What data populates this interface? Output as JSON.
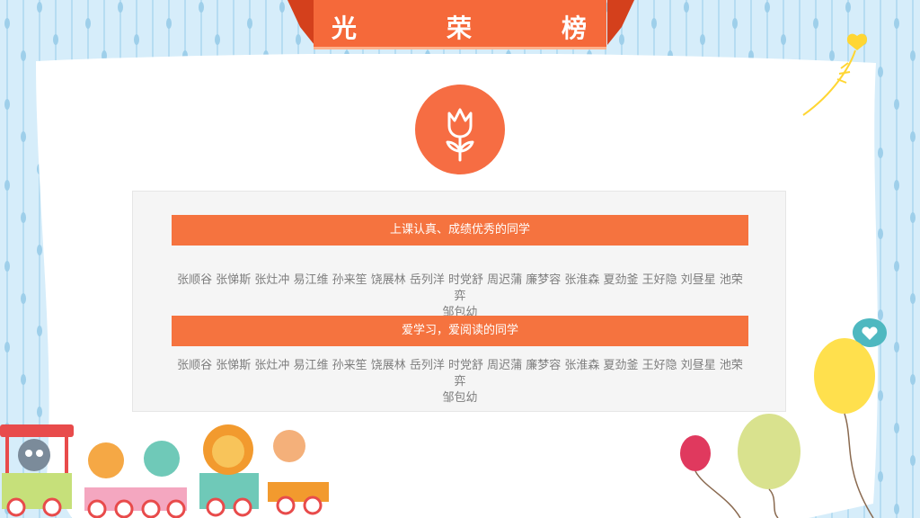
{
  "header": {
    "title_chars": [
      "光",
      "荣",
      "榜"
    ]
  },
  "icons": {
    "emblem": "tulip-icon",
    "bubble": "heart-speech-bubble-icon"
  },
  "sections": [
    {
      "heading": "上课认真、成绩优秀的同学",
      "names_line1": "张顺谷 张悌斯 张灶冲 易江维 孙来笙 饶展林 岳列洋 时党舒 周迟蒲 廉梦容  张淮森 夏劲釜 王好隐 刘昼星 池荣弈",
      "names_line2": "邹包幼"
    },
    {
      "heading": "爱学习，爱阅读的同学",
      "names_line1": "张顺谷 张悌斯 张灶冲 易江维 孙来笙 饶展林 岳列洋 时党舒 周迟蒲 廉梦容  张淮森 夏劲釜 王好隐 刘昼星 池荣弈",
      "names_line2": "邹包幼"
    }
  ],
  "colors": {
    "accent": "#f5733f",
    "title_bar": "#f5693a",
    "ribbon_dark": "#d4401c",
    "background": "#d6edfa",
    "card": "#ffffff",
    "panel": "#f5f5f5",
    "text_gray": "#7e7e7e"
  }
}
